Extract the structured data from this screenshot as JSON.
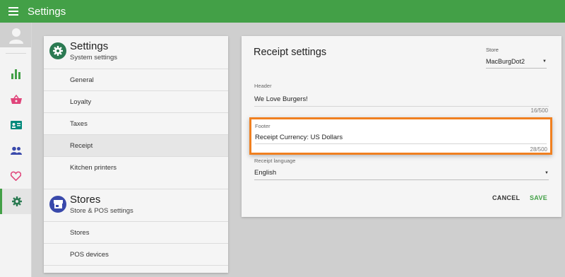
{
  "app": {
    "title": "Settings"
  },
  "colors": {
    "brand": "#43a047",
    "highlight": "#f08020",
    "settings_icon_bg": "#2b7a52",
    "stores_icon_bg": "#3949ab"
  },
  "rail": {
    "items": [
      {
        "icon": "bar-chart-icon",
        "color": "#43a047"
      },
      {
        "icon": "basket-icon",
        "color": "#e0447a"
      },
      {
        "icon": "contact-card-icon",
        "color": "#00897b"
      },
      {
        "icon": "people-icon",
        "color": "#3949ab"
      },
      {
        "icon": "heart-icon",
        "color": "#e0447a"
      },
      {
        "icon": "gear-icon",
        "color": "#2b7a52",
        "active": true
      }
    ]
  },
  "settings_group": {
    "title": "Settings",
    "subtitle": "System settings",
    "items": [
      "General",
      "Loyalty",
      "Taxes",
      "Receipt",
      "Kitchen printers"
    ],
    "active": "Receipt"
  },
  "stores_group": {
    "title": "Stores",
    "subtitle": "Store & POS settings",
    "items": [
      "Stores",
      "POS devices"
    ]
  },
  "receipt": {
    "title": "Receipt settings",
    "store_label": "Store",
    "store_value": "MacBurgDot2",
    "header_label": "Header",
    "header_value": "We Love Burgers!",
    "header_counter": "16/500",
    "footer_label": "Footer",
    "footer_value": "Receipt Currency: US Dollars",
    "footer_counter": "28/500",
    "language_label": "Receipt language",
    "language_value": "English",
    "cancel_label": "CANCEL",
    "save_label": "SAVE"
  }
}
